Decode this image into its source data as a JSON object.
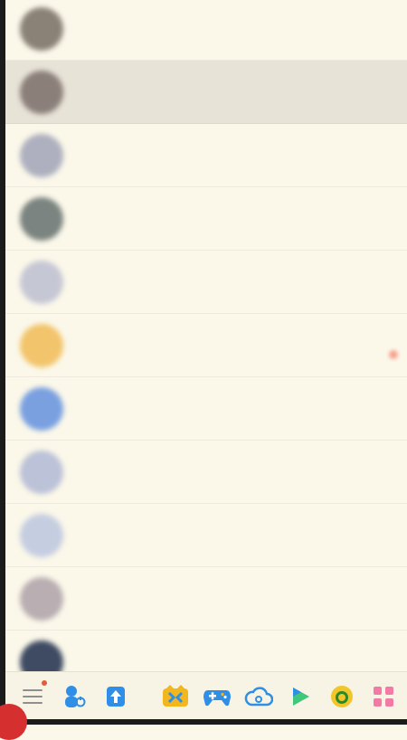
{
  "conversations": [
    {
      "title": "",
      "preview": "",
      "time": "",
      "title_red": false,
      "avatar_color": "#8a8276",
      "selected": false,
      "badge": false
    },
    {
      "title": "",
      "preview": "",
      "time": "",
      "title_red": false,
      "avatar_color": "#8b7f7a",
      "selected": true,
      "badge": false
    },
    {
      "title": "",
      "preview": "",
      "time": "",
      "title_red": true,
      "avatar_color": "#aeb0bf",
      "selected": false,
      "badge": false
    },
    {
      "title": "",
      "preview": "",
      "time": "",
      "title_red": true,
      "avatar_color": "#7b8480",
      "selected": false,
      "badge": false
    },
    {
      "title": "",
      "preview": "",
      "time": "",
      "title_red": true,
      "avatar_color": "#c6c7d4",
      "selected": false,
      "badge": false
    },
    {
      "title": "",
      "preview": "",
      "time": "",
      "title_red": false,
      "avatar_color": "#f2c46b",
      "selected": false,
      "badge": true
    },
    {
      "title": "",
      "preview": "",
      "time": "",
      "title_red": false,
      "avatar_color": "#7aa0e0",
      "selected": false,
      "badge": false
    },
    {
      "title": "",
      "preview": "",
      "time": "",
      "title_red": true,
      "avatar_color": "#bcc2d8",
      "selected": false,
      "badge": false
    },
    {
      "title": "",
      "preview": "",
      "time": "",
      "title_red": true,
      "avatar_color": "#c5cde0",
      "selected": false,
      "badge": false
    },
    {
      "title": "",
      "preview": "",
      "time": "",
      "title_red": true,
      "avatar_color": "#b9aeb2",
      "selected": false,
      "badge": false
    },
    {
      "title": "",
      "preview": "",
      "time": "",
      "title_red": false,
      "avatar_color": "#3e4b62",
      "selected": false,
      "badge": false
    }
  ],
  "toolbar": {
    "items": [
      {
        "icon": "menu-icon",
        "has_dot": true
      },
      {
        "icon": "contacts-icon",
        "has_dot": false
      },
      {
        "icon": "file-transfer-icon",
        "has_dot": false
      },
      {
        "icon": "games-hub-icon",
        "has_dot": false
      },
      {
        "icon": "gamepad-icon",
        "has_dot": false
      },
      {
        "icon": "cloud-icon",
        "has_dot": false
      },
      {
        "icon": "video-play-icon",
        "has_dot": false
      },
      {
        "icon": "mascot-icon",
        "has_dot": false
      },
      {
        "icon": "app-grid-icon",
        "has_dot": false
      }
    ]
  },
  "colors": {
    "background": "#fbf8ea",
    "selected_row": "#e7e3d7",
    "accent_red": "#f06a58",
    "icon_blue": "#2f8fe6",
    "icon_yellow": "#f2b71f",
    "icon_pink": "#f27aa5",
    "icon_green": "#41c77a"
  }
}
